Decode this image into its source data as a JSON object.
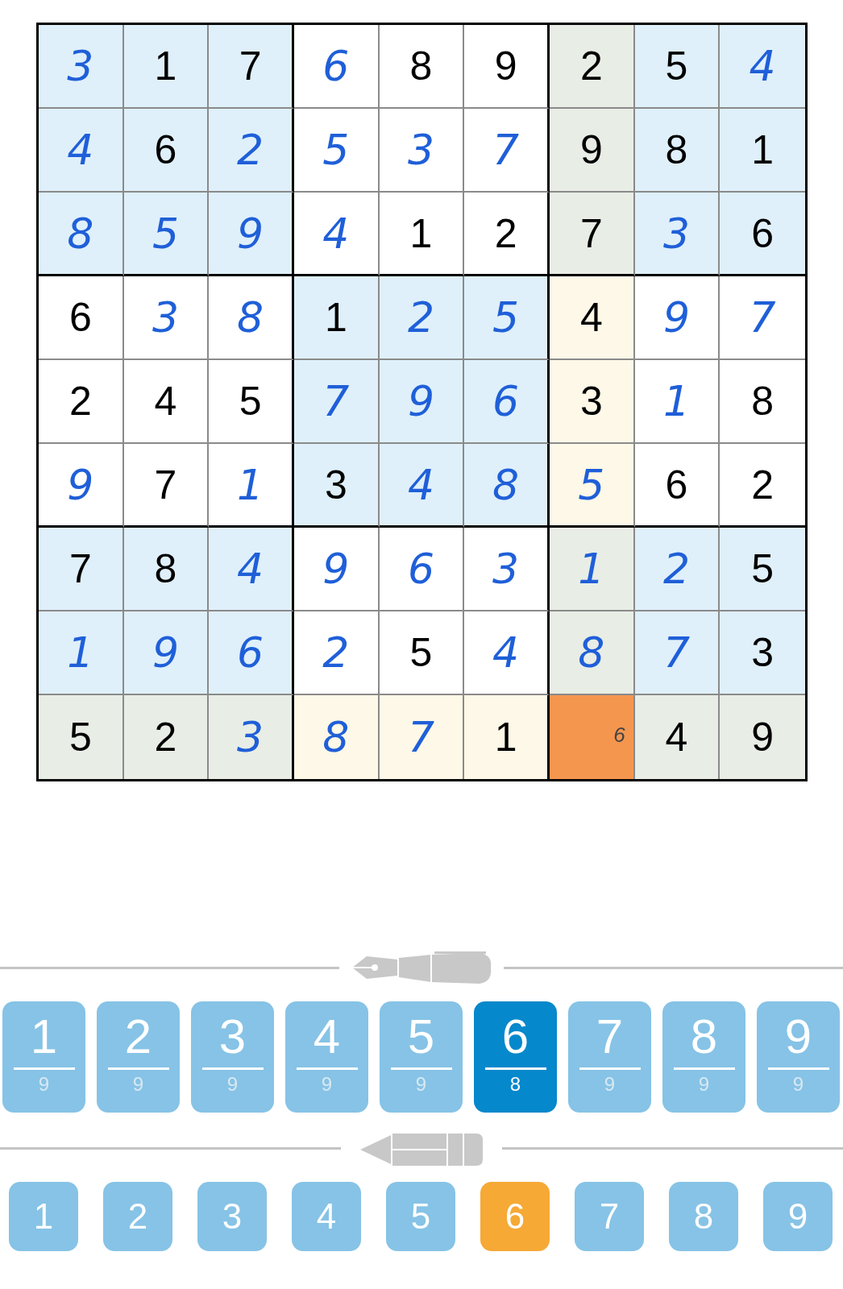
{
  "grid": {
    "rows": [
      [
        {
          "value": "3",
          "kind": "entered",
          "color": "#dff0fb"
        },
        {
          "value": "1",
          "kind": "given",
          "color": "#dff0fb"
        },
        {
          "value": "7",
          "kind": "given",
          "color": "#dff0fb"
        },
        {
          "value": "6",
          "kind": "entered",
          "color": "#ffffff"
        },
        {
          "value": "8",
          "kind": "given",
          "color": "#ffffff"
        },
        {
          "value": "9",
          "kind": "given",
          "color": "#ffffff"
        },
        {
          "value": "2",
          "kind": "given",
          "color": "#e8ede6"
        },
        {
          "value": "5",
          "kind": "given",
          "color": "#dff0fb"
        },
        {
          "value": "4",
          "kind": "entered",
          "color": "#dff0fb"
        }
      ],
      [
        {
          "value": "4",
          "kind": "entered",
          "color": "#dff0fb"
        },
        {
          "value": "6",
          "kind": "given",
          "color": "#dff0fb"
        },
        {
          "value": "2",
          "kind": "entered",
          "color": "#dff0fb"
        },
        {
          "value": "5",
          "kind": "entered",
          "color": "#ffffff"
        },
        {
          "value": "3",
          "kind": "entered",
          "color": "#ffffff"
        },
        {
          "value": "7",
          "kind": "entered",
          "color": "#ffffff"
        },
        {
          "value": "9",
          "kind": "given",
          "color": "#e8ede6"
        },
        {
          "value": "8",
          "kind": "given",
          "color": "#dff0fb"
        },
        {
          "value": "1",
          "kind": "given",
          "color": "#dff0fb"
        }
      ],
      [
        {
          "value": "8",
          "kind": "entered",
          "color": "#dff0fb"
        },
        {
          "value": "5",
          "kind": "entered",
          "color": "#dff0fb"
        },
        {
          "value": "9",
          "kind": "entered",
          "color": "#dff0fb"
        },
        {
          "value": "4",
          "kind": "entered",
          "color": "#ffffff"
        },
        {
          "value": "1",
          "kind": "given",
          "color": "#ffffff"
        },
        {
          "value": "2",
          "kind": "given",
          "color": "#ffffff"
        },
        {
          "value": "7",
          "kind": "given",
          "color": "#e8ede6"
        },
        {
          "value": "3",
          "kind": "entered",
          "color": "#dff0fb"
        },
        {
          "value": "6",
          "kind": "given",
          "color": "#dff0fb"
        }
      ],
      [
        {
          "value": "6",
          "kind": "given",
          "color": "#ffffff"
        },
        {
          "value": "3",
          "kind": "entered",
          "color": "#ffffff"
        },
        {
          "value": "8",
          "kind": "entered",
          "color": "#ffffff"
        },
        {
          "value": "1",
          "kind": "given",
          "color": "#dff0fb"
        },
        {
          "value": "2",
          "kind": "entered",
          "color": "#dff0fb"
        },
        {
          "value": "5",
          "kind": "entered",
          "color": "#dff0fb"
        },
        {
          "value": "4",
          "kind": "given",
          "color": "#fdf8e7"
        },
        {
          "value": "9",
          "kind": "entered",
          "color": "#ffffff"
        },
        {
          "value": "7",
          "kind": "entered",
          "color": "#ffffff"
        }
      ],
      [
        {
          "value": "2",
          "kind": "given",
          "color": "#ffffff"
        },
        {
          "value": "4",
          "kind": "given",
          "color": "#ffffff"
        },
        {
          "value": "5",
          "kind": "given",
          "color": "#ffffff"
        },
        {
          "value": "7",
          "kind": "entered",
          "color": "#dff0fb"
        },
        {
          "value": "9",
          "kind": "entered",
          "color": "#dff0fb"
        },
        {
          "value": "6",
          "kind": "entered",
          "color": "#dff0fb"
        },
        {
          "value": "3",
          "kind": "given",
          "color": "#fdf8e7"
        },
        {
          "value": "1",
          "kind": "entered",
          "color": "#ffffff"
        },
        {
          "value": "8",
          "kind": "given",
          "color": "#ffffff"
        }
      ],
      [
        {
          "value": "9",
          "kind": "entered",
          "color": "#ffffff"
        },
        {
          "value": "7",
          "kind": "given",
          "color": "#ffffff"
        },
        {
          "value": "1",
          "kind": "entered",
          "color": "#ffffff"
        },
        {
          "value": "3",
          "kind": "given",
          "color": "#dff0fb"
        },
        {
          "value": "4",
          "kind": "entered",
          "color": "#dff0fb"
        },
        {
          "value": "8",
          "kind": "entered",
          "color": "#dff0fb"
        },
        {
          "value": "5",
          "kind": "entered",
          "color": "#fdf8e7"
        },
        {
          "value": "6",
          "kind": "given",
          "color": "#ffffff"
        },
        {
          "value": "2",
          "kind": "given",
          "color": "#ffffff"
        }
      ],
      [
        {
          "value": "7",
          "kind": "given",
          "color": "#dff0fb"
        },
        {
          "value": "8",
          "kind": "given",
          "color": "#dff0fb"
        },
        {
          "value": "4",
          "kind": "entered",
          "color": "#dff0fb"
        },
        {
          "value": "9",
          "kind": "entered",
          "color": "#ffffff"
        },
        {
          "value": "6",
          "kind": "entered",
          "color": "#ffffff"
        },
        {
          "value": "3",
          "kind": "entered",
          "color": "#ffffff"
        },
        {
          "value": "1",
          "kind": "entered",
          "color": "#e8ede6"
        },
        {
          "value": "2",
          "kind": "entered",
          "color": "#dff0fb"
        },
        {
          "value": "5",
          "kind": "given",
          "color": "#dff0fb"
        }
      ],
      [
        {
          "value": "1",
          "kind": "entered",
          "color": "#dff0fb"
        },
        {
          "value": "9",
          "kind": "entered",
          "color": "#dff0fb"
        },
        {
          "value": "6",
          "kind": "entered",
          "color": "#dff0fb"
        },
        {
          "value": "2",
          "kind": "entered",
          "color": "#ffffff"
        },
        {
          "value": "5",
          "kind": "given",
          "color": "#ffffff"
        },
        {
          "value": "4",
          "kind": "entered",
          "color": "#ffffff"
        },
        {
          "value": "8",
          "kind": "entered",
          "color": "#e8ede6"
        },
        {
          "value": "7",
          "kind": "entered",
          "color": "#dff0fb"
        },
        {
          "value": "3",
          "kind": "given",
          "color": "#dff0fb"
        }
      ],
      [
        {
          "value": "5",
          "kind": "given",
          "color": "#e8ede6"
        },
        {
          "value": "2",
          "kind": "given",
          "color": "#e8ede6"
        },
        {
          "value": "3",
          "kind": "entered",
          "color": "#e8ede6"
        },
        {
          "value": "8",
          "kind": "entered",
          "color": "#fdf8e7"
        },
        {
          "value": "7",
          "kind": "entered",
          "color": "#fdf8e7"
        },
        {
          "value": "1",
          "kind": "given",
          "color": "#fdf8e7"
        },
        {
          "value": "6",
          "kind": "note",
          "color": "#f5964f"
        },
        {
          "value": "4",
          "kind": "given",
          "color": "#e8ede6"
        },
        {
          "value": "9",
          "kind": "given",
          "color": "#e8ede6"
        }
      ]
    ]
  },
  "pen_keys": [
    {
      "digit": "1",
      "count": "9",
      "selected": false
    },
    {
      "digit": "2",
      "count": "9",
      "selected": false
    },
    {
      "digit": "3",
      "count": "9",
      "selected": false
    },
    {
      "digit": "4",
      "count": "9",
      "selected": false
    },
    {
      "digit": "5",
      "count": "9",
      "selected": false
    },
    {
      "digit": "6",
      "count": "8",
      "selected": true
    },
    {
      "digit": "7",
      "count": "9",
      "selected": false
    },
    {
      "digit": "8",
      "count": "9",
      "selected": false
    },
    {
      "digit": "9",
      "count": "9",
      "selected": false
    }
  ],
  "pencil_keys": [
    {
      "digit": "1",
      "selected": false
    },
    {
      "digit": "2",
      "selected": false
    },
    {
      "digit": "3",
      "selected": false
    },
    {
      "digit": "4",
      "selected": false
    },
    {
      "digit": "5",
      "selected": false
    },
    {
      "digit": "6",
      "selected": true
    },
    {
      "digit": "7",
      "selected": false
    },
    {
      "digit": "8",
      "selected": false
    },
    {
      "digit": "9",
      "selected": false
    }
  ]
}
